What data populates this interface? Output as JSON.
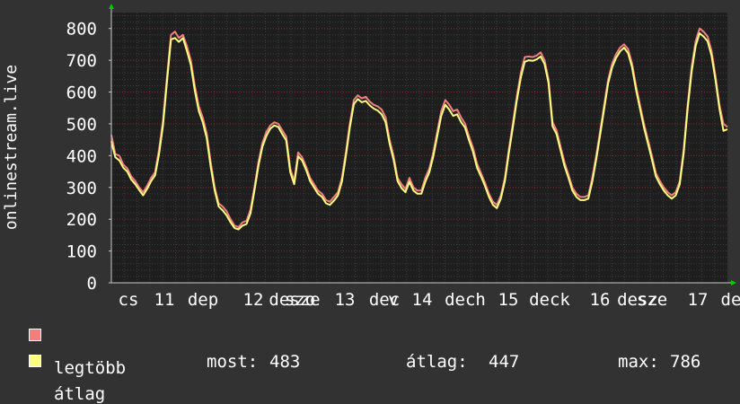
{
  "chart_data": {
    "type": "line",
    "ylabel": "onlinestream.live",
    "xlabel": "",
    "title": "",
    "ylim": [
      0,
      850
    ],
    "yticks": [
      0,
      100,
      200,
      300,
      400,
      500,
      600,
      700,
      800
    ],
    "x_tick_labels": [
      "cs",
      "11",
      "dep",
      "12",
      "desze",
      "szo",
      "13",
      "dec",
      "v",
      "14",
      "dech",
      "15",
      "deck",
      "16",
      "desz",
      "sze",
      "17",
      "de"
    ],
    "grid": true,
    "legend_position": "bottom-left",
    "series": [
      {
        "name": "legtöbb",
        "color": "#f27f7f",
        "values": [
          465,
          405,
          400,
          372,
          360,
          335,
          320,
          300,
          285,
          305,
          330,
          348,
          420,
          510,
          650,
          780,
          790,
          770,
          780,
          745,
          700,
          620,
          555,
          520,
          470,
          380,
          300,
          250,
          240,
          225,
          200,
          180,
          175,
          190,
          195,
          230,
          300,
          380,
          440,
          475,
          495,
          505,
          500,
          480,
          460,
          360,
          320,
          410,
          395,
          365,
          330,
          310,
          290,
          280,
          260,
          255,
          270,
          285,
          330,
          410,
          500,
          575,
          590,
          580,
          585,
          570,
          560,
          555,
          545,
          520,
          450,
          400,
          330,
          310,
          295,
          330,
          300,
          290,
          290,
          330,
          360,
          410,
          475,
          540,
          575,
          560,
          540,
          545,
          520,
          500,
          460,
          425,
          375,
          345,
          315,
          280,
          255,
          245,
          275,
          330,
          420,
          500,
          585,
          660,
          710,
          712,
          710,
          715,
          725,
          700,
          640,
          505,
          480,
          430,
          380,
          340,
          300,
          280,
          270,
          270,
          275,
          330,
          400,
          480,
          560,
          640,
          690,
          720,
          740,
          750,
          735,
          690,
          620,
          560,
          500,
          450,
          400,
          345,
          320,
          300,
          285,
          275,
          285,
          320,
          420,
          560,
          680,
          760,
          800,
          790,
          775,
          730,
          650,
          560,
          500,
          490
        ]
      },
      {
        "name": "átlag",
        "color": "#ffff7f",
        "values": [
          445,
          395,
          385,
          362,
          350,
          325,
          310,
          292,
          275,
          295,
          320,
          338,
          405,
          495,
          635,
          765,
          770,
          758,
          770,
          730,
          685,
          605,
          540,
          505,
          455,
          365,
          290,
          240,
          228,
          212,
          190,
          172,
          168,
          180,
          185,
          218,
          290,
          368,
          428,
          462,
          485,
          495,
          490,
          468,
          448,
          348,
          310,
          398,
          385,
          355,
          320,
          300,
          280,
          270,
          250,
          245,
          258,
          275,
          318,
          398,
          488,
          562,
          578,
          568,
          572,
          558,
          548,
          542,
          530,
          505,
          438,
          388,
          320,
          298,
          285,
          318,
          290,
          280,
          280,
          318,
          348,
          398,
          462,
          525,
          560,
          545,
          525,
          530,
          505,
          488,
          448,
          412,
          362,
          335,
          305,
          270,
          245,
          235,
          265,
          320,
          408,
          488,
          572,
          645,
          695,
          700,
          698,
          703,
          712,
          688,
          628,
          492,
          468,
          418,
          368,
          330,
          290,
          270,
          260,
          260,
          265,
          318,
          388,
          468,
          548,
          628,
          678,
          708,
          728,
          740,
          722,
          678,
          608,
          548,
          488,
          438,
          388,
          335,
          310,
          290,
          275,
          265,
          275,
          310,
          408,
          548,
          665,
          745,
          785,
          775,
          760,
          715,
          638,
          548,
          478,
          483
        ]
      }
    ],
    "stats": {
      "most_label": "most:",
      "most_value": "483",
      "atlag_label": "átlag:",
      "atlag_value": "447",
      "max_label": "max:",
      "max_value": "786"
    }
  },
  "colors": {
    "background": "#323232",
    "plot_background": "#1e1e1e",
    "grid_minor": "#3c3c3c",
    "grid_major": "#ff3c3c",
    "axis": "#c8c8c8",
    "arrow": "#00cc00"
  }
}
